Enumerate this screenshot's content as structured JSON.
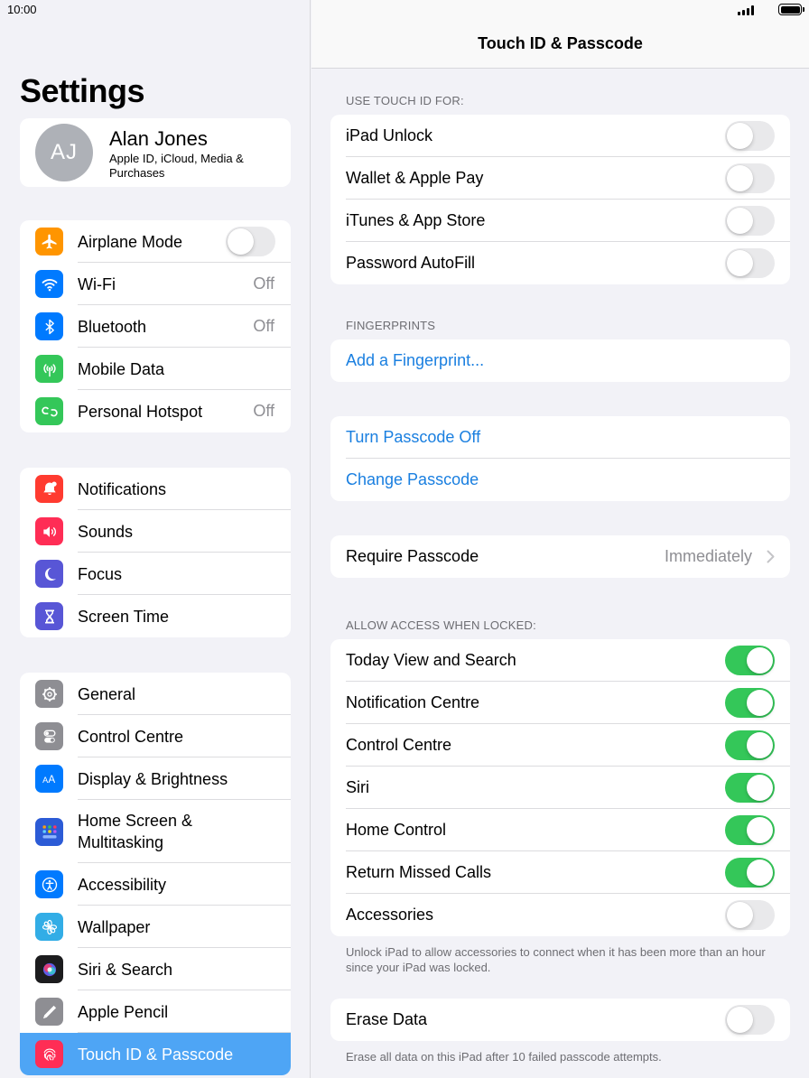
{
  "status_bar": {
    "time": "10:00"
  },
  "sidebar": {
    "title": "Settings",
    "profile": {
      "initials": "AJ",
      "name": "Alan Jones",
      "subtitle": "Apple ID, iCloud, Media & Purchases"
    },
    "groups": [
      {
        "items": [
          {
            "label": "Airplane Mode",
            "icon": "airplane-icon",
            "color": "#ff9500",
            "toggle": false
          },
          {
            "label": "Wi-Fi",
            "icon": "wifi-icon",
            "color": "#007aff",
            "value": "Off"
          },
          {
            "label": "Bluetooth",
            "icon": "bluetooth-icon",
            "color": "#007aff",
            "value": "Off"
          },
          {
            "label": "Mobile Data",
            "icon": "antenna-icon",
            "color": "#34c759"
          },
          {
            "label": "Personal Hotspot",
            "icon": "hotspot-icon",
            "color": "#34c759",
            "value": "Off"
          }
        ]
      },
      {
        "items": [
          {
            "label": "Notifications",
            "icon": "bell-icon",
            "color": "#ff3b30"
          },
          {
            "label": "Sounds",
            "icon": "speaker-icon",
            "color": "#ff2d55"
          },
          {
            "label": "Focus",
            "icon": "moon-icon",
            "color": "#5856d6"
          },
          {
            "label": "Screen Time",
            "icon": "hourglass-icon",
            "color": "#5856d6"
          }
        ]
      },
      {
        "items": [
          {
            "label": "General",
            "icon": "gear-icon",
            "color": "#8e8e93"
          },
          {
            "label": "Control Centre",
            "icon": "switches-icon",
            "color": "#8e8e93"
          },
          {
            "label": "Display & Brightness",
            "icon": "text-size-icon",
            "color": "#007aff"
          },
          {
            "label": "Home Screen & Multitasking",
            "icon": "app-grid-icon",
            "color": "#2c5bd6"
          },
          {
            "label": "Accessibility",
            "icon": "accessibility-icon",
            "color": "#007aff"
          },
          {
            "label": "Wallpaper",
            "icon": "flower-icon",
            "color": "#32ade6"
          },
          {
            "label": "Siri & Search",
            "icon": "siri-icon",
            "color": "#1c1c1e"
          },
          {
            "label": "Apple Pencil",
            "icon": "pencil-icon",
            "color": "#8e8e93"
          },
          {
            "label": "Touch ID & Passcode",
            "icon": "fingerprint-icon",
            "color": "#ff2d55",
            "selected": true
          }
        ]
      }
    ]
  },
  "detail": {
    "title": "Touch ID & Passcode",
    "use_touch_id_header": "USE TOUCH ID FOR:",
    "use_touch_id": [
      {
        "label": "iPad Unlock",
        "on": false
      },
      {
        "label": "Wallet & Apple Pay",
        "on": false
      },
      {
        "label": "iTunes & App Store",
        "on": false
      },
      {
        "label": "Password AutoFill",
        "on": false
      }
    ],
    "fingerprints_header": "FINGERPRINTS",
    "add_fingerprint": "Add a Fingerprint...",
    "turn_passcode_off": "Turn Passcode Off",
    "change_passcode": "Change Passcode",
    "require_passcode": {
      "label": "Require Passcode",
      "value": "Immediately"
    },
    "allow_access_header": "ALLOW ACCESS WHEN LOCKED:",
    "allow_access": [
      {
        "label": "Today View and Search",
        "on": true
      },
      {
        "label": "Notification Centre",
        "on": true
      },
      {
        "label": "Control Centre",
        "on": true
      },
      {
        "label": "Siri",
        "on": true
      },
      {
        "label": "Home Control",
        "on": true
      },
      {
        "label": "Return Missed Calls",
        "on": true
      },
      {
        "label": "Accessories",
        "on": false
      }
    ],
    "accessories_footer": "Unlock iPad to allow accessories to connect when it has been more than an hour since your iPad was locked.",
    "erase_data": {
      "label": "Erase Data",
      "on": false
    },
    "erase_footer": "Erase all data on this iPad after 10 failed passcode attempts."
  }
}
